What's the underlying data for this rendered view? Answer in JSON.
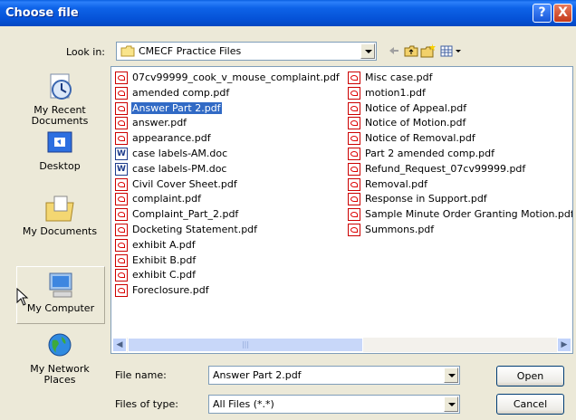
{
  "title_bar": {
    "title": "Choose file",
    "help": "?",
    "close": "X"
  },
  "look_in": {
    "label": "Look in:",
    "value": "CMECF Practice Files"
  },
  "toolbar_icons": [
    "back-icon",
    "up-folder-icon",
    "new-folder-icon",
    "view-menu-icon"
  ],
  "places": [
    {
      "label": "My Recent Documents",
      "icon": "recent-documents-icon"
    },
    {
      "label": "Desktop",
      "icon": "desktop-icon"
    },
    {
      "label": "My Documents",
      "icon": "my-documents-icon"
    },
    {
      "label": "My Computer",
      "icon": "my-computer-icon"
    },
    {
      "label": "My Network Places",
      "icon": "network-places-icon"
    }
  ],
  "files_col1": [
    {
      "name": "07cv99999_cook_v_mouse_complaint.pdf",
      "type": "pdf"
    },
    {
      "name": "amended comp.pdf",
      "type": "pdf"
    },
    {
      "name": "Answer Part 2.pdf",
      "type": "pdf",
      "selected": true
    },
    {
      "name": "answer.pdf",
      "type": "pdf"
    },
    {
      "name": "appearance.pdf",
      "type": "pdf"
    },
    {
      "name": "case labels-AM.doc",
      "type": "doc"
    },
    {
      "name": "case labels-PM.doc",
      "type": "doc"
    },
    {
      "name": "Civil Cover Sheet.pdf",
      "type": "pdf"
    },
    {
      "name": "complaint.pdf",
      "type": "pdf"
    },
    {
      "name": "Complaint_Part_2.pdf",
      "type": "pdf"
    },
    {
      "name": "Docketing Statement.pdf",
      "type": "pdf"
    },
    {
      "name": "exhibit A.pdf",
      "type": "pdf"
    },
    {
      "name": "Exhibit B.pdf",
      "type": "pdf"
    },
    {
      "name": "exhibit C.pdf",
      "type": "pdf"
    },
    {
      "name": "Foreclosure.pdf",
      "type": "pdf"
    }
  ],
  "files_col2": [
    {
      "name": "Misc case.pdf",
      "type": "pdf"
    },
    {
      "name": "motion1.pdf",
      "type": "pdf"
    },
    {
      "name": "Notice of Appeal.pdf",
      "type": "pdf"
    },
    {
      "name": "Notice of Motion.pdf",
      "type": "pdf"
    },
    {
      "name": "Notice of Removal.pdf",
      "type": "pdf"
    },
    {
      "name": "Part 2 amended comp.pdf",
      "type": "pdf"
    },
    {
      "name": "Refund_Request_07cv99999.pdf",
      "type": "pdf"
    },
    {
      "name": "Removal.pdf",
      "type": "pdf"
    },
    {
      "name": "Response in Support.pdf",
      "type": "pdf"
    },
    {
      "name": "Sample Minute Order Granting Motion.pdf",
      "type": "pdf"
    },
    {
      "name": "Summons.pdf",
      "type": "pdf"
    }
  ],
  "file_name": {
    "label": "File name:",
    "value": "Answer Part 2.pdf"
  },
  "files_of_type": {
    "label": "Files of type:",
    "value": "All Files (*.*)"
  },
  "buttons": {
    "open": "Open",
    "cancel": "Cancel"
  },
  "colors": {
    "title_bar": "#0551D6",
    "selection": "#316AC5",
    "dialog_bg": "#ECE9D8"
  }
}
